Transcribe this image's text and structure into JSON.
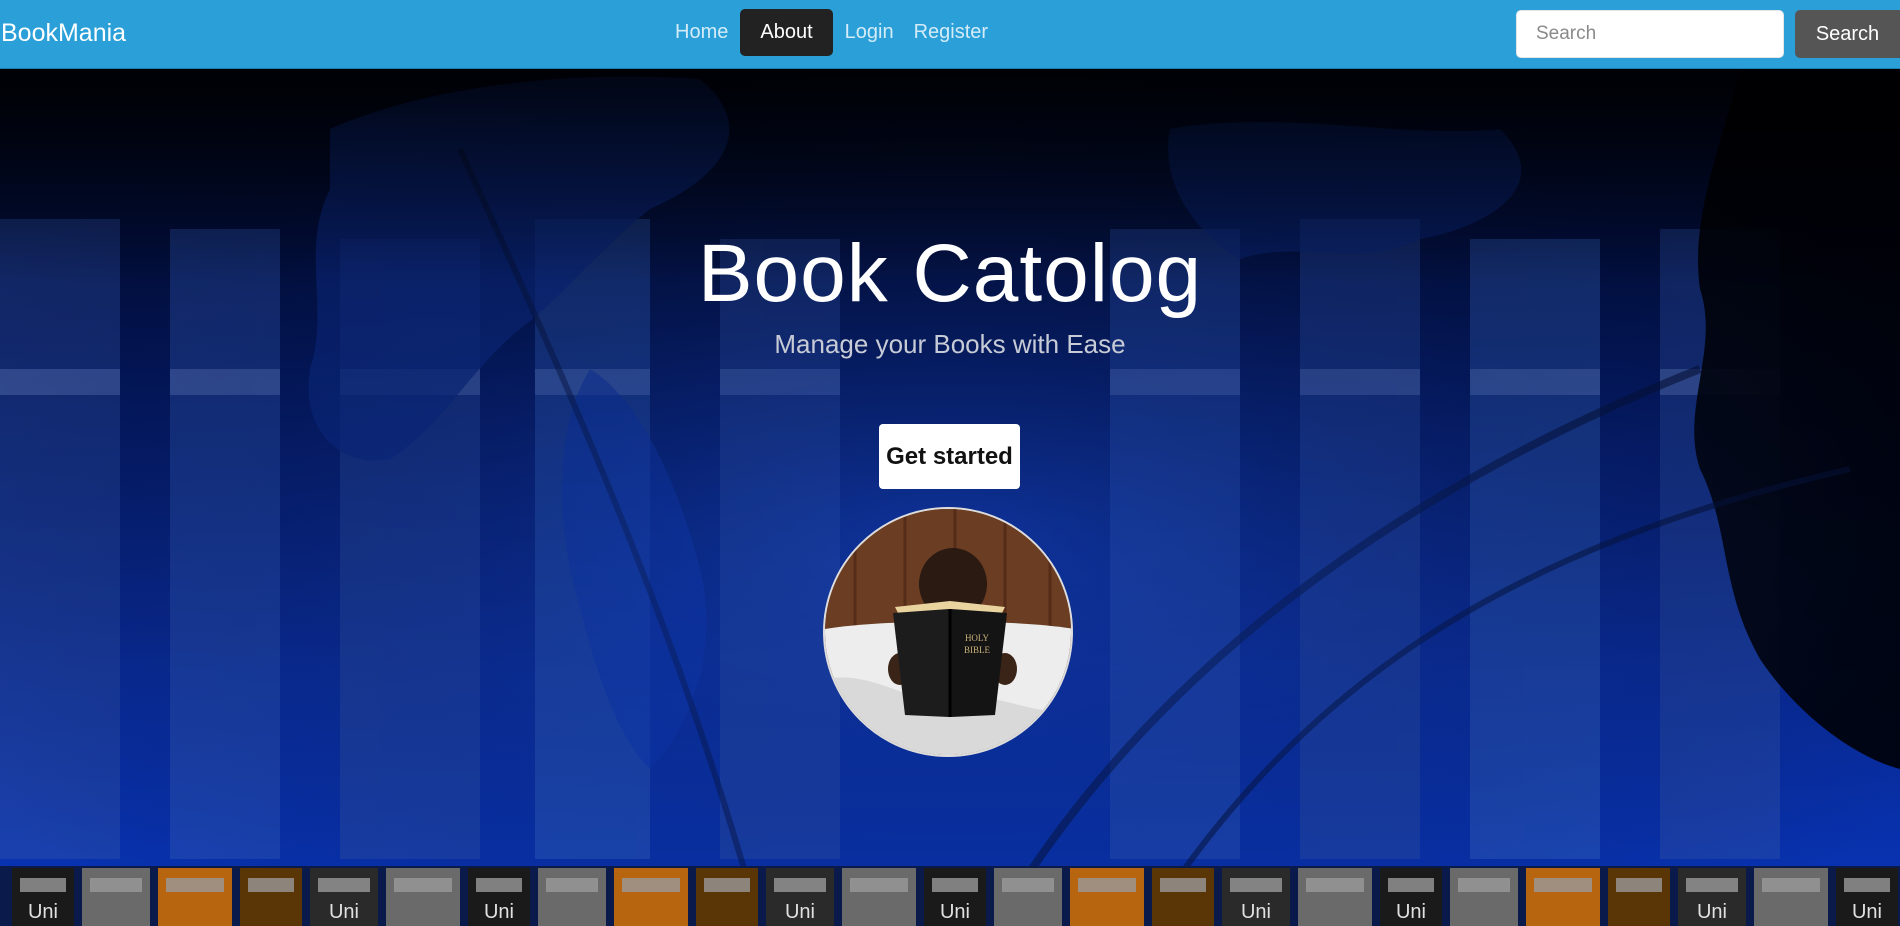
{
  "navbar": {
    "brand": "BookMania",
    "links": [
      {
        "label": "Home",
        "active": false
      },
      {
        "label": "About",
        "active": true
      },
      {
        "label": "Login",
        "active": false
      },
      {
        "label": "Register",
        "active": false
      }
    ],
    "search_placeholder": "Search",
    "search_button": "Search",
    "bg_color": "#2a9fd8"
  },
  "hero": {
    "title": "Book Catolog",
    "subtitle": "Manage your Books with Ease",
    "cta_label": "Get started",
    "book_cover_text": "HOLY BIBLE",
    "spine_label": "Uni"
  }
}
